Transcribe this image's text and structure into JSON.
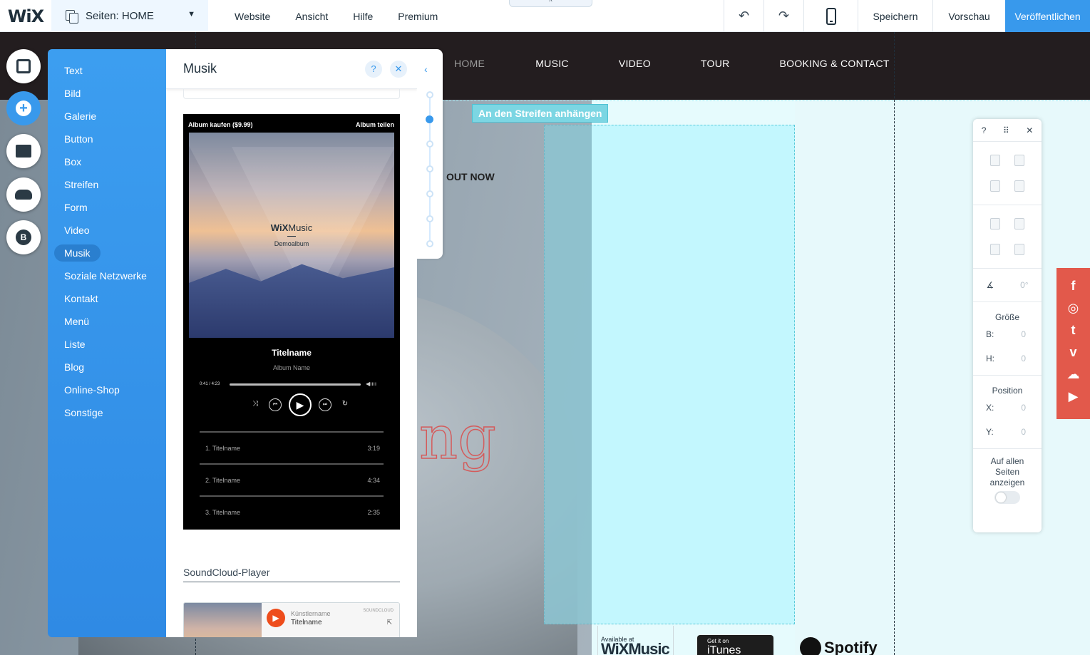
{
  "topbar": {
    "logo": "WiX",
    "pages_label": "Seiten: HOME",
    "menu": [
      "Website",
      "Ansicht",
      "Hilfe",
      "Premium"
    ],
    "undo_icon": "↶",
    "redo_icon": "↷",
    "save": "Speichern",
    "preview": "Vorschau",
    "publish": "Veröffentlichen",
    "collapse_icon": "^"
  },
  "site": {
    "nav": [
      "HOME",
      "MUSIC",
      "VIDEO",
      "TOUR",
      "BOOKING & CONTACT"
    ],
    "strip_label": "An den Streifen anhängen",
    "out_now": "OUT NOW",
    "script_text": "ng",
    "badge_wix_small": "Available at",
    "badge_wix_big": "WiXMusic",
    "badge_itunes_small": "Get it on",
    "badge_itunes_big": "iTunes",
    "badge_spotify": "Spotify",
    "accent_color": "#3899ec",
    "social_color": "#e2594b",
    "social_icons": [
      "f",
      "◎",
      "t",
      "v",
      "☁",
      "▶"
    ]
  },
  "left_toolbar": {
    "blog_letter": "B",
    "add_symbol": "+"
  },
  "add_panel": {
    "categories": [
      "Text",
      "Bild",
      "Galerie",
      "Button",
      "Box",
      "Streifen",
      "Form",
      "Video",
      "Musik",
      "Soziale Netzwerke",
      "Kontakt",
      "Menü",
      "Liste",
      "Blog",
      "Online-Shop",
      "Sonstige"
    ],
    "active_category": "Musik",
    "title": "Musik",
    "help": "?",
    "close": "✕",
    "back": "‹",
    "player": {
      "buy": "Album kaufen ($9.99)",
      "share": "Album teilen",
      "logo_bold": "WiX",
      "logo_rest": "Music",
      "album_cover_text": "Demoalbum",
      "track_title": "Titelname",
      "album_name": "Album Name",
      "time": "0:41 / 4:23",
      "volume": "◀ıııı",
      "controls": [
        "⤨",
        "⏮",
        "▶",
        "⏭",
        "↻"
      ],
      "tracks": [
        {
          "name": "1.  Titelname",
          "duration": "3:19"
        },
        {
          "name": "2.  Titelname",
          "duration": "4:34"
        },
        {
          "name": "3.  Titelname",
          "duration": "2:35"
        }
      ]
    },
    "soundcloud": {
      "title": "SoundCloud-Player",
      "artist": "Künstlername",
      "track": "Titelname",
      "brand": "SOUNDCLOUD",
      "play": "▶",
      "share": "⇱"
    }
  },
  "inspector": {
    "help": "?",
    "drag": "⠿",
    "close": "✕",
    "angle_icon": "∡",
    "angle_value": "0°",
    "size_title": "Größe",
    "size_w_label": "B:",
    "size_w_value": "0",
    "size_h_label": "H:",
    "size_h_value": "0",
    "position_title": "Position",
    "pos_x_label": "X:",
    "pos_x_value": "0",
    "pos_y_label": "Y:",
    "pos_y_value": "0",
    "show_all_pages": "Auf allen Seiten anzeigen"
  }
}
